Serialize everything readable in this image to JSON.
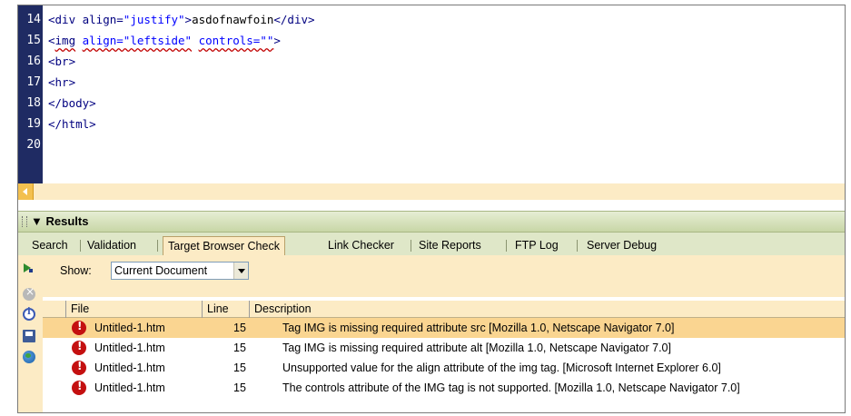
{
  "editor": {
    "lines": [
      {
        "num": "14",
        "segments": [
          {
            "t": "<div align=",
            "c": "tag"
          },
          {
            "t": "\"justify\"",
            "c": "str"
          },
          {
            "t": ">",
            "c": "tag"
          },
          {
            "t": "asdofnawfoin",
            "c": "txt"
          },
          {
            "t": "</div>",
            "c": "tag"
          }
        ]
      },
      {
        "num": "15",
        "segments": [
          {
            "t": "<",
            "c": "tag"
          },
          {
            "t": "img",
            "c": "tag wavy"
          },
          {
            "t": " ",
            "c": "tag"
          },
          {
            "t": "align=\"leftside\"",
            "c": "str wavy"
          },
          {
            "t": " ",
            "c": "tag"
          },
          {
            "t": "controls=\"\"",
            "c": "str wavy"
          },
          {
            "t": ">",
            "c": "tag"
          }
        ]
      },
      {
        "num": "16",
        "segments": [
          {
            "t": "<br>",
            "c": "tag"
          }
        ]
      },
      {
        "num": "17",
        "segments": [
          {
            "t": "<hr>",
            "c": "tag"
          }
        ]
      },
      {
        "num": "18",
        "segments": [
          {
            "t": "</body>",
            "c": "tag"
          }
        ]
      },
      {
        "num": "19",
        "segments": [
          {
            "t": "</html>",
            "c": "tag"
          }
        ]
      },
      {
        "num": "20",
        "segments": []
      }
    ]
  },
  "results": {
    "title": "Results",
    "tabs": [
      "Search",
      "Validation",
      "Target Browser Check",
      "Link Checker",
      "Site Reports",
      "FTP Log",
      "Server Debug"
    ],
    "active_tab": "Target Browser Check",
    "show_label": "Show:",
    "show_value": "Current Document",
    "columns": {
      "file": "File",
      "line": "Line",
      "description": "Description"
    },
    "rows": [
      {
        "file": "Untitled-1.htm",
        "line": "15",
        "description": "Tag IMG is missing required attribute src [Mozilla 1.0, Netscape Navigator 7.0]",
        "selected": true
      },
      {
        "file": "Untitled-1.htm",
        "line": "15",
        "description": "Tag IMG is missing required attribute alt [Mozilla 1.0, Netscape Navigator 7.0]",
        "selected": false
      },
      {
        "file": "Untitled-1.htm",
        "line": "15",
        "description": "Unsupported value for the align attribute of the img tag. [Microsoft Internet Explorer 6.0]",
        "selected": false
      },
      {
        "file": "Untitled-1.htm",
        "line": "15",
        "description": "The controls attribute of the IMG tag is not supported. [Mozilla 1.0, Netscape Navigator 7.0]",
        "selected": false
      }
    ]
  },
  "colors": {
    "gutter": "#1f2b63",
    "panel_bg": "#fcebc5",
    "selected_row": "#fad591",
    "error": "#c41010"
  }
}
